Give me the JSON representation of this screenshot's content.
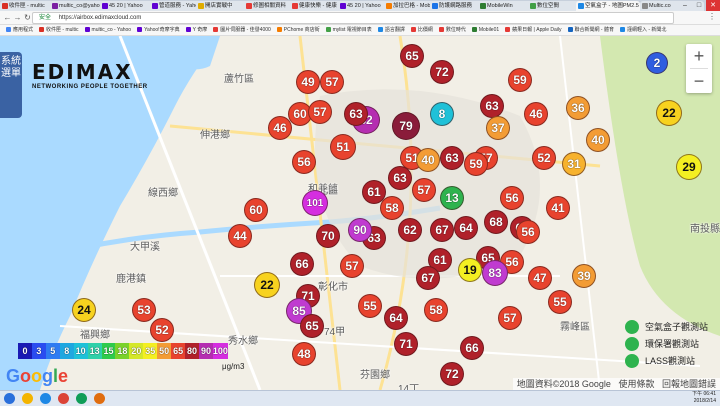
{
  "browser": {
    "tabs": [
      {
        "label": "收件匣 - multic",
        "color": "#d93025"
      },
      {
        "label": "multic_co@yahoo",
        "color": "#7b1fa2"
      },
      {
        "label": "45 20 | Yahoo",
        "color": "#6001d2"
      },
      {
        "label": "管道服務 - Yahoo",
        "color": "#6001d2"
      },
      {
        "label": "開店實戰中",
        "color": "#e0ac00"
      },
      {
        "label": "修圖相關資料",
        "color": "#e53935"
      },
      {
        "label": "健康快樂 - 健康",
        "color": "#e53935"
      },
      {
        "label": "45 20 | Yahoo",
        "color": "#6001d2"
      },
      {
        "label": "加拉巴格 - Mobile",
        "color": "#f57c00"
      },
      {
        "label": "防護網路服務",
        "color": "#1a73e8"
      },
      {
        "label": "MobileWin",
        "color": "#2e7d32"
      },
      {
        "label": "數位空間",
        "color": "#43a047"
      },
      {
        "label": "空氣盒子 - 地圖PM2.5",
        "color": "#1e88e5",
        "active": true
      },
      {
        "label": "Multic.co",
        "color": "#888888"
      }
    ],
    "url": "https://airbox.edimaxcloud.com",
    "secure_label": "安全",
    "bookmarks": [
      {
        "label": "應用程式",
        "color": "#4285f4"
      },
      {
        "label": "收件匣 - multic",
        "color": "#d93025"
      },
      {
        "label": "multic_co - Yahoo",
        "color": "#6001d2"
      },
      {
        "label": "Yahoo!奇摩字典",
        "color": "#6001d2"
      },
      {
        "label": "Y 奇摩",
        "color": "#6001d2"
      },
      {
        "label": "圖片伺服器 - 佳發4000",
        "color": "#e53935"
      },
      {
        "label": "PChome 商店街",
        "color": "#f57c00"
      },
      {
        "label": "mylist 電視節目表",
        "color": "#43a047"
      },
      {
        "label": "語言翻譯",
        "color": "#1e88e5"
      },
      {
        "label": "比價網",
        "color": "#e53935"
      },
      {
        "label": "數位時代",
        "color": "#e53935"
      },
      {
        "label": "Mobile01",
        "color": "#2e7d32"
      },
      {
        "label": "蘋果日報 | Apple Daily",
        "color": "#e53935"
      },
      {
        "label": "聯合新聞網 - 體育",
        "color": "#1565c0"
      },
      {
        "label": "謹網輕入 - 新聞北",
        "color": "#1e88e5"
      }
    ]
  },
  "sidebar": {
    "label": "系統選單"
  },
  "logo": {
    "wordmark": "EDIMAX",
    "tagline": "NETWORKING PEOPLE TOGETHER"
  },
  "places": [
    {
      "name": "蘆竹區"
    },
    {
      "name": "伸港鄉"
    },
    {
      "name": "線西鄉"
    },
    {
      "name": "和美鎮"
    },
    {
      "name": "鹿港鎮"
    },
    {
      "name": "福興鄉"
    },
    {
      "name": "秀水鄉"
    },
    {
      "name": "彰化市"
    },
    {
      "name": "芬園鄉"
    },
    {
      "name": "霧峰區"
    },
    {
      "name": "南投縣"
    },
    {
      "name": "74甲"
    },
    {
      "name": "14丁"
    },
    {
      "name": "北區"
    },
    {
      "name": "大甲溪"
    }
  ],
  "markers": [
    {
      "v": 2,
      "c": "#2f5ee0"
    },
    {
      "v": 22,
      "c": "#f7d21f",
      "dark": true
    },
    {
      "v": 29,
      "c": "#f4ef22",
      "dark": true
    },
    {
      "v": 49,
      "c": "#e8432e"
    },
    {
      "v": 57,
      "c": "#e8432e"
    },
    {
      "v": 60,
      "c": "#e8432e"
    },
    {
      "v": 65,
      "c": "#b0212a"
    },
    {
      "v": 51,
      "c": "#e8432e"
    },
    {
      "v": 56,
      "c": "#e8432e"
    },
    {
      "v": 36,
      "c": "#f39c35"
    },
    {
      "v": 40,
      "c": "#f39c35"
    },
    {
      "v": 46,
      "c": "#e8432e"
    },
    {
      "v": 57,
      "c": "#e8432e"
    },
    {
      "v": 82,
      "c": "#b52eb1"
    },
    {
      "v": 79,
      "c": "#8a1c3a"
    },
    {
      "v": 72,
      "c": "#b0212a"
    },
    {
      "v": 63,
      "c": "#b0212a"
    },
    {
      "v": 59,
      "c": "#e8432e"
    },
    {
      "v": 37,
      "c": "#f39c35"
    },
    {
      "v": 46,
      "c": "#e8432e"
    },
    {
      "v": 57,
      "c": "#e8432e"
    },
    {
      "v": 51,
      "c": "#e8432e"
    },
    {
      "v": 52,
      "c": "#e8432e"
    },
    {
      "v": 31,
      "c": "#f7b22d"
    },
    {
      "v": 57,
      "c": "#e8432e"
    },
    {
      "v": 56,
      "c": "#e8432e"
    },
    {
      "v": 40,
      "c": "#f39c35"
    },
    {
      "v": 59,
      "c": "#e8432e"
    },
    {
      "v": 63,
      "c": "#b0212a"
    },
    {
      "v": 61,
      "c": "#b0212a"
    },
    {
      "v": 101,
      "c": "#d52ee0"
    },
    {
      "v": 58,
      "c": "#e8432e"
    },
    {
      "v": 13,
      "c": "#2eb34e"
    },
    {
      "v": 41,
      "c": "#e8432e"
    },
    {
      "v": 63,
      "c": "#b0212a"
    },
    {
      "v": 44,
      "c": "#e8432e"
    },
    {
      "v": 60,
      "c": "#e8432e"
    },
    {
      "v": 67,
      "c": "#b0212a"
    },
    {
      "v": 62,
      "c": "#b0212a"
    },
    {
      "v": 63,
      "c": "#b0212a"
    },
    {
      "v": 90,
      "c": "#c03bd0"
    },
    {
      "v": 64,
      "c": "#b0212a"
    },
    {
      "v": 68,
      "c": "#b0212a"
    },
    {
      "v": 65,
      "c": "#b0212a"
    },
    {
      "v": 63,
      "c": "#b0212a"
    },
    {
      "v": 56,
      "c": "#e8432e"
    },
    {
      "v": 61,
      "c": "#b0212a"
    },
    {
      "v": 66,
      "c": "#b0212a"
    },
    {
      "v": 56,
      "c": "#e8432e"
    },
    {
      "v": 19,
      "c": "#f4ef22",
      "dark": true
    },
    {
      "v": 83,
      "c": "#c03bd0"
    },
    {
      "v": 67,
      "c": "#b0212a"
    },
    {
      "v": 47,
      "c": "#e8432e"
    },
    {
      "v": 39,
      "c": "#f39c35"
    },
    {
      "v": 22,
      "c": "#f7d21f",
      "dark": true
    },
    {
      "v": 71,
      "c": "#b0212a"
    },
    {
      "v": 58,
      "c": "#e8432e"
    },
    {
      "v": 57,
      "c": "#e8432e"
    },
    {
      "v": 55,
      "c": "#e8432e"
    },
    {
      "v": 24,
      "c": "#f7d21f",
      "dark": true
    },
    {
      "v": 53,
      "c": "#e8432e"
    },
    {
      "v": 52,
      "c": "#e8432e"
    },
    {
      "v": 85,
      "c": "#c03bd0"
    },
    {
      "v": 65,
      "c": "#b0212a"
    },
    {
      "v": 64,
      "c": "#b0212a"
    },
    {
      "v": 66,
      "c": "#b0212a"
    },
    {
      "v": 48,
      "c": "#e8432e"
    },
    {
      "v": 72,
      "c": "#b0212a"
    },
    {
      "v": 71,
      "c": "#b0212a"
    },
    {
      "v": 55,
      "c": "#e8432e"
    },
    {
      "v": 57,
      "c": "#e8432e"
    },
    {
      "v": 63,
      "c": "#b0212a"
    },
    {
      "v": 70,
      "c": "#b0212a"
    },
    {
      "v": 8,
      "c": "#1fc1d8"
    }
  ],
  "scale": {
    "labels": [
      "0",
      "3",
      "5",
      "8",
      "10",
      "13",
      "15",
      "18",
      "20",
      "35",
      "50",
      "65",
      "80",
      "90",
      "100"
    ],
    "colors": [
      "#1a1ab4",
      "#2a4cf0",
      "#2f7bf2",
      "#1fa7e0",
      "#1fc1d8",
      "#2fd0a9",
      "#2ecb4b",
      "#7bd22b",
      "#d4e72a",
      "#f4ef22",
      "#f39c35",
      "#e8432e",
      "#b0212a",
      "#b52eb1",
      "#d52ee0"
    ],
    "unit": "μg/m3"
  },
  "legend": [
    {
      "label": "空氣盒子觀測站",
      "color": "#2eb34e"
    },
    {
      "label": "環保署觀測站",
      "color": "#2eb34e"
    },
    {
      "label": "LASS觀測站",
      "color": "#2eb34e"
    }
  ],
  "zoom": {
    "in": "+",
    "out": "−"
  },
  "attribution": {
    "data": "地圖資料©2018 Google",
    "terms": "使用條款",
    "report": "回報地圖錯誤"
  },
  "google_logo": "Google",
  "taskbar": {
    "time": "下午 06:41",
    "date": "2018/2/14",
    "lang": "中"
  }
}
